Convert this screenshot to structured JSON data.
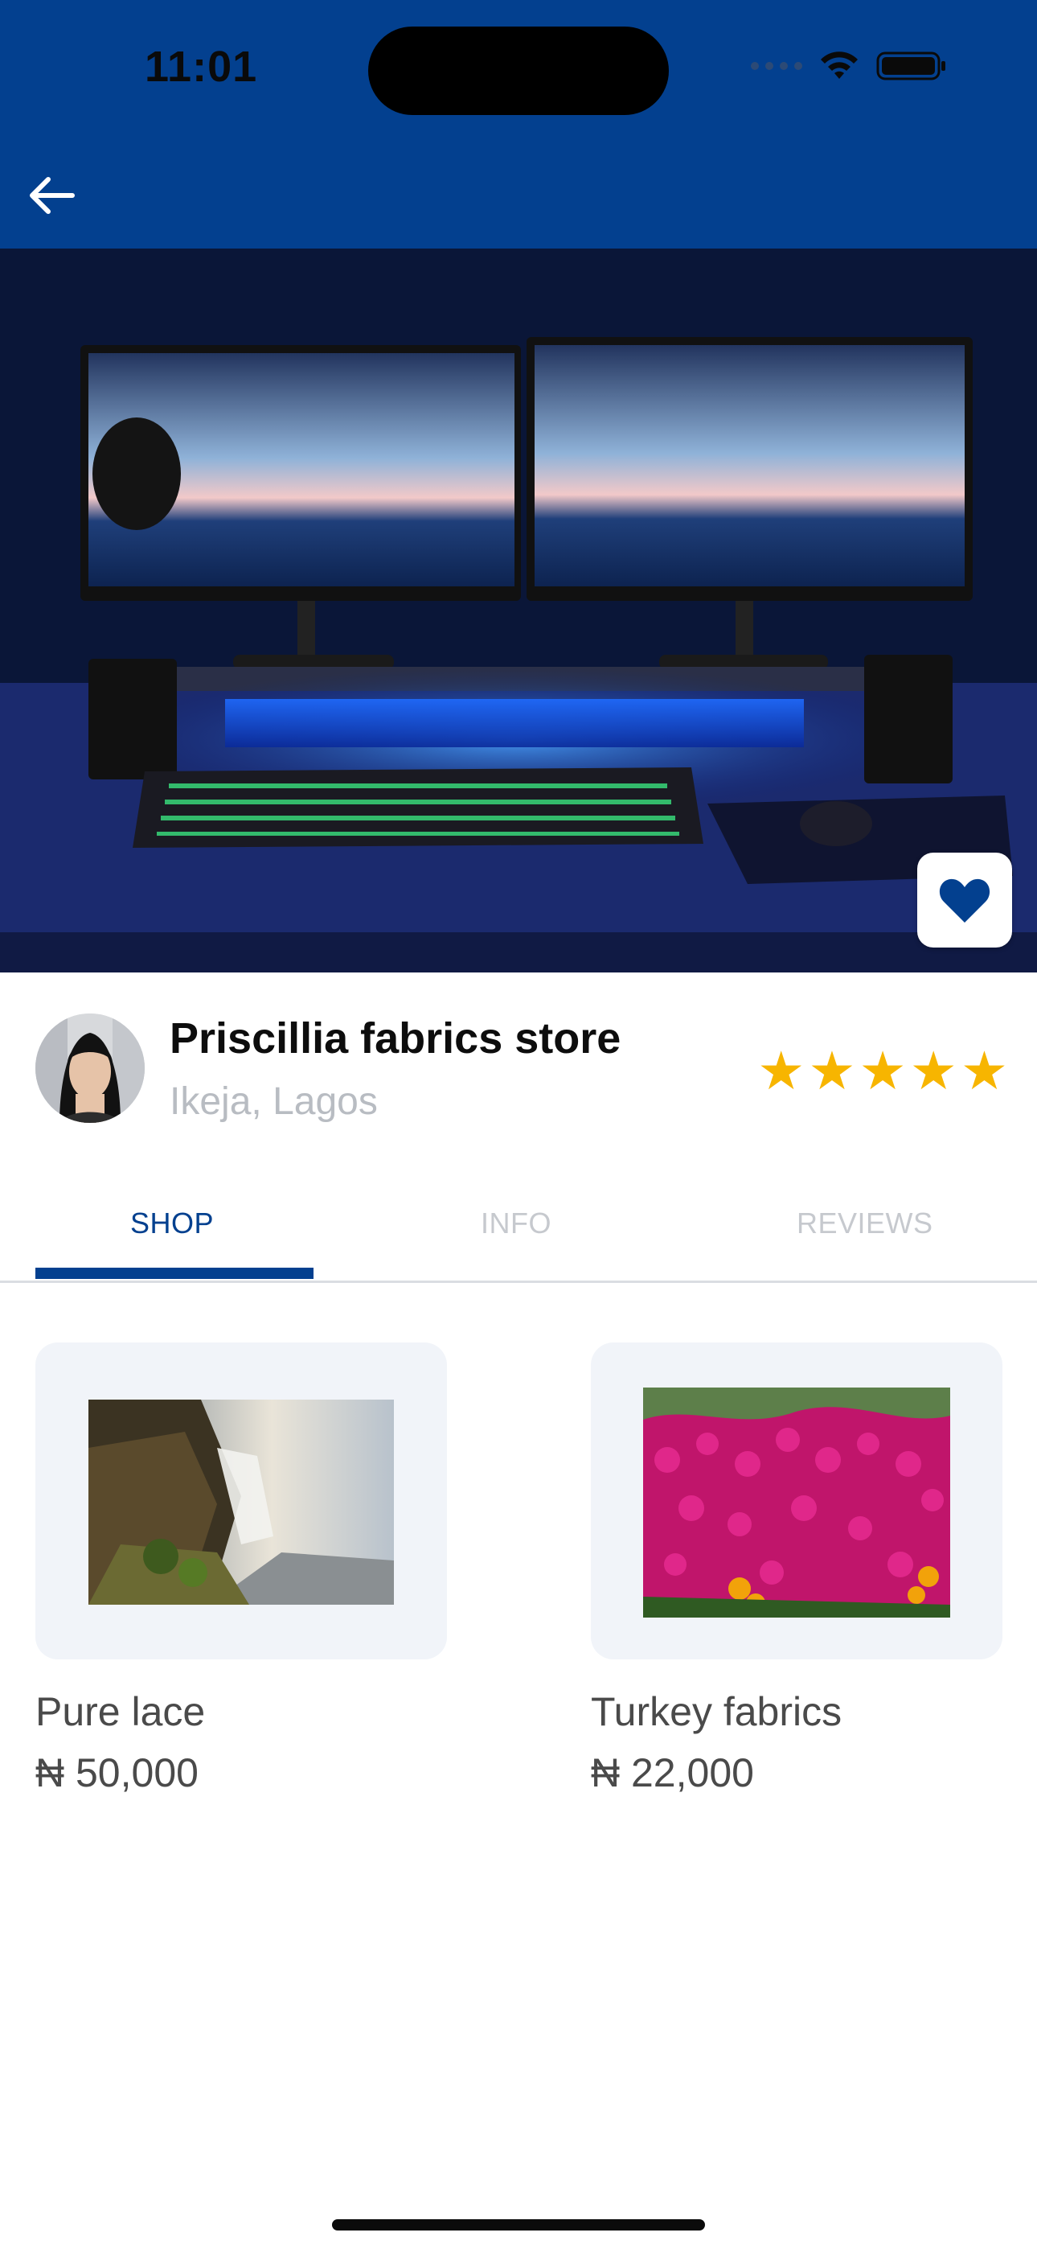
{
  "status_bar": {
    "time": "11:01"
  },
  "store": {
    "name": "Priscillia fabrics store",
    "location": "Ikeja, Lagos",
    "rating": 5,
    "rating_max": 5
  },
  "tabs": [
    {
      "label": "SHOP",
      "active": true
    },
    {
      "label": "INFO",
      "active": false
    },
    {
      "label": "REVIEWS",
      "active": false
    }
  ],
  "products": [
    {
      "name": "Pure lace",
      "price": "₦ 50,000"
    },
    {
      "name": "Turkey fabrics",
      "price": "₦ 22,000"
    }
  ],
  "colors": {
    "primary": "#03408f",
    "star": "#f7b500",
    "card_bg": "#f1f4f9"
  },
  "icons": {
    "back": "arrow-left-icon",
    "favorite": "heart-icon",
    "signal": "signal-dots-icon",
    "wifi": "wifi-icon",
    "battery": "battery-icon"
  }
}
